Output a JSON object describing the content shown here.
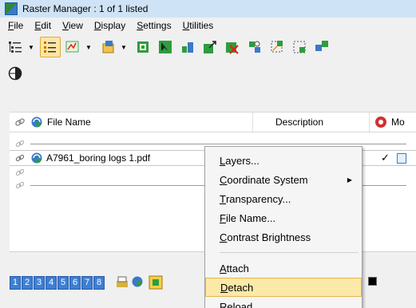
{
  "window": {
    "title": "Raster Manager : 1 of 1 listed"
  },
  "menubar": {
    "items": [
      "File",
      "Edit",
      "View",
      "Display",
      "Settings",
      "Utilities"
    ]
  },
  "list": {
    "columns": {
      "file": "File Name",
      "description": "Description",
      "m": "Mo"
    },
    "selected_file": "A7961_boring logs 1.pdf",
    "check": "✓"
  },
  "statusbar": {
    "views": [
      "1",
      "2",
      "3",
      "4",
      "5",
      "6",
      "7",
      "8"
    ]
  },
  "context_menu": {
    "items": [
      {
        "first": "L",
        "rest": "ayers..."
      },
      {
        "first": "C",
        "rest": "oordinate System"
      },
      {
        "first": "T",
        "rest": "ransparency..."
      },
      {
        "first": "F",
        "rest": "ile Name..."
      },
      {
        "first": "C",
        "rest": "ontrast Brightness"
      },
      {
        "first": "A",
        "rest": "ttach"
      },
      {
        "first": "D",
        "rest": "etach"
      },
      {
        "first": "R",
        "rest": "eload"
      }
    ],
    "highlighted": "Detach"
  },
  "colors": {
    "title_bg": "#cfe3f6",
    "highlight": "#fce9a8",
    "view_button": "#3d7fd6"
  }
}
